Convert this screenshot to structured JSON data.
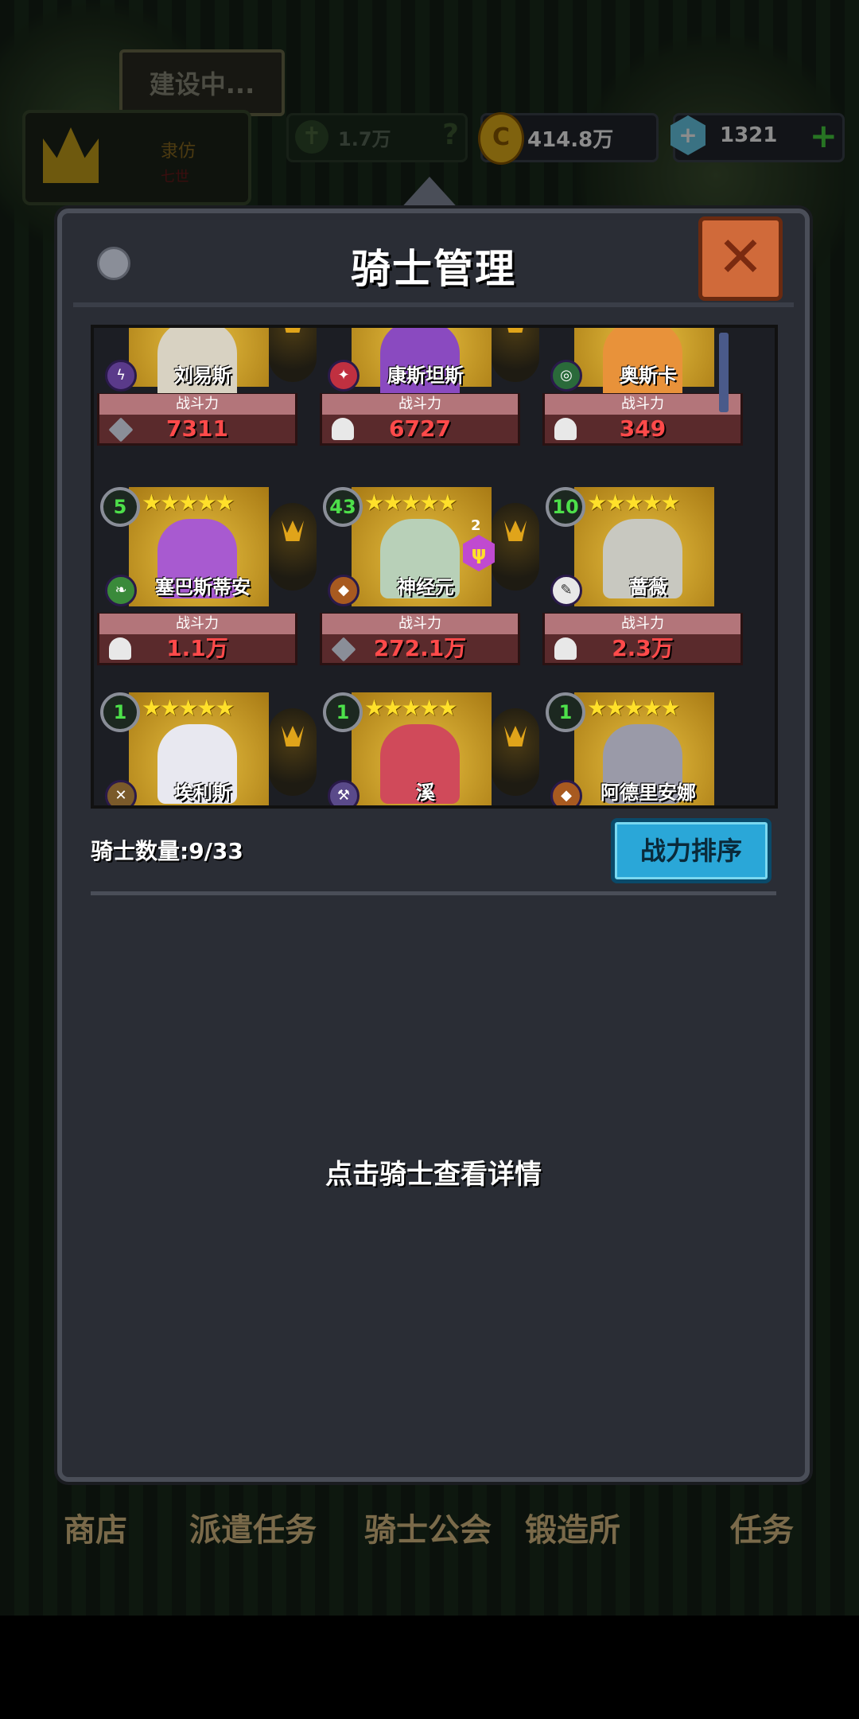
{
  "top": {
    "building_label": "建设中...",
    "crown_title": "隶仿",
    "crown_sub": "七世",
    "green_resource": "1.7万",
    "green_q": "?",
    "gold_value": "414.8万",
    "gold_icon": "C",
    "gem_value": "1321",
    "gem_icon": "+",
    "gem_plus": "+"
  },
  "panel": {
    "title": "骑士管理",
    "close_icon": "✕",
    "count_label": "骑士数量:9/33",
    "sort_button": "战力排序",
    "hint": "点击骑士查看详情"
  },
  "power_label": "战斗力",
  "knights": [
    {
      "name": "刘易斯",
      "level": "",
      "power": "7311",
      "power_icon": "sword",
      "class_icon": "ϟ"
    },
    {
      "name": "康斯坦斯",
      "level": "",
      "power": "6727",
      "power_icon": "cake",
      "class_icon": "✦"
    },
    {
      "name": "奥斯卡",
      "level": "",
      "power": "349",
      "power_icon": "cake",
      "class_icon": "◎"
    },
    {
      "name": "塞巴斯蒂安",
      "level": "5",
      "power": "1.1万",
      "power_icon": "cake",
      "class_icon": "❧"
    },
    {
      "name": "神经元",
      "level": "43",
      "power": "272.1万",
      "power_icon": "sword",
      "class_icon": "◆",
      "badge": "ψ",
      "badge_count": "2"
    },
    {
      "name": "蔷薇",
      "level": "10",
      "power": "2.3万",
      "power_icon": "cake",
      "class_icon": "✎"
    },
    {
      "name": "埃利斯",
      "level": "1",
      "power": "",
      "power_icon": "",
      "class_icon": "✕"
    },
    {
      "name": "溪",
      "level": "1",
      "power": "",
      "power_icon": "",
      "class_icon": "⚒"
    },
    {
      "name": "阿德里安娜",
      "level": "1",
      "power": "",
      "power_icon": "",
      "class_icon": "◆"
    }
  ],
  "stars": "★★★★★",
  "bottom_nav": [
    "商店",
    "派遣任务",
    "骑士公会",
    "锻造所",
    "任务"
  ],
  "colors": {
    "accent_blue": "#2aa7d8",
    "power_red": "#ff4a4a",
    "card_gold": "#c9a12a",
    "level_green": "#4de04a"
  }
}
